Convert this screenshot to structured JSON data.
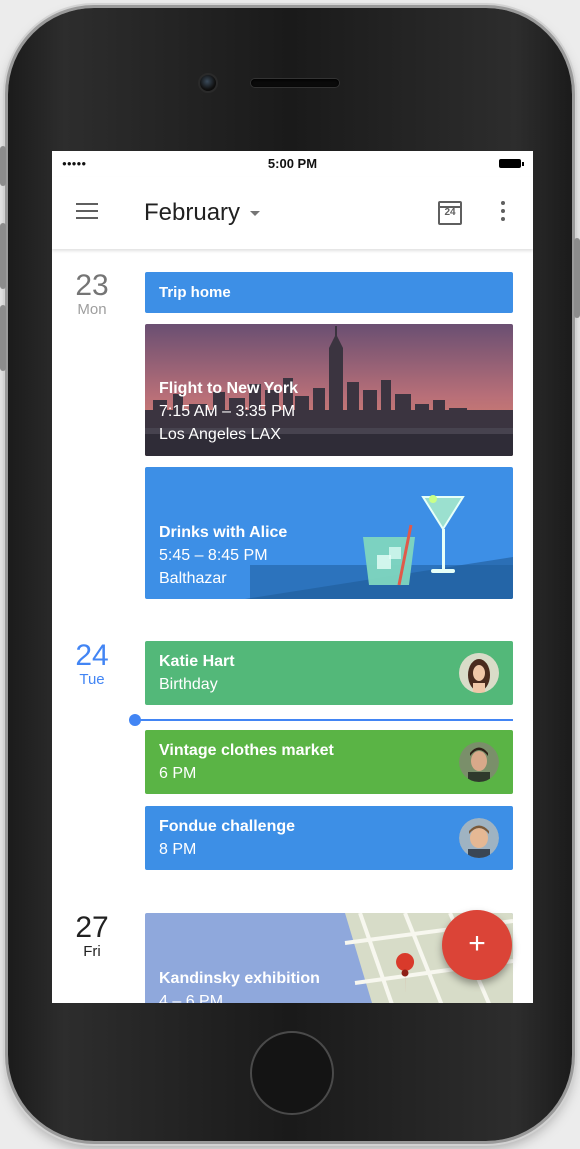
{
  "status_bar": {
    "signal": "●●●●●",
    "time": "5:00 PM"
  },
  "app_bar": {
    "month": "February",
    "today_day": "24"
  },
  "days": [
    {
      "number": "23",
      "name": "Mon"
    },
    {
      "number": "24",
      "name": "Tue"
    },
    {
      "number": "27",
      "name": "Fri"
    }
  ],
  "events": {
    "trip": {
      "title": "Trip home"
    },
    "flight": {
      "title": "Flight to New York",
      "time": "7:15 AM – 3:35 PM",
      "location": "Los Angeles LAX"
    },
    "drinks": {
      "title": "Drinks with Alice",
      "time": "5:45 – 8:45 PM",
      "location": "Balthazar"
    },
    "katie": {
      "title": "Katie Hart",
      "subtitle": "Birthday"
    },
    "vintage": {
      "title": "Vintage clothes market",
      "time": "6 PM"
    },
    "fondue": {
      "title": "Fondue challenge",
      "time": "8 PM"
    },
    "kandinsky": {
      "title": "Kandinsky exhibition",
      "time": "4 – 6 PM"
    }
  },
  "fab": {
    "label": "+"
  },
  "colors": {
    "blue": "#3d8fe6",
    "green": "#53b879",
    "lime": "#5ab445",
    "fab": "#db4437",
    "accent": "#4285f4"
  }
}
